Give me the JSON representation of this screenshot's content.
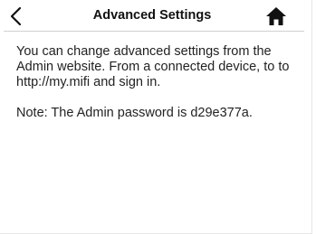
{
  "header": {
    "title": "Advanced Settings",
    "back_icon": "chevron-left-icon",
    "home_icon": "home-icon"
  },
  "content": {
    "description": "You can change advanced settings from the Admin website. From a connected device, to to http://my.mifi and sign in.",
    "note": "Note: The Admin password is d29e377a."
  },
  "colors": {
    "text": "#222222",
    "title": "#111111",
    "background": "#ffffff"
  }
}
